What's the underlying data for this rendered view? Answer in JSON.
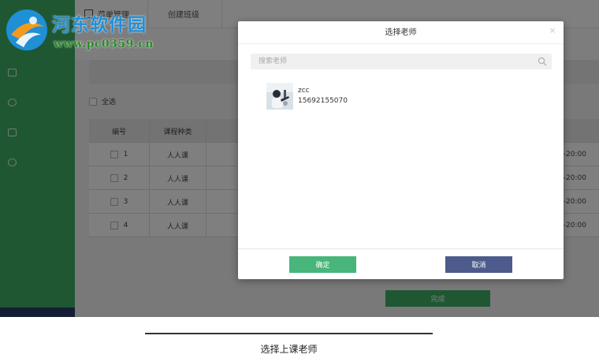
{
  "background": {
    "top_tabs": [
      "菜单管理",
      "创建班级"
    ],
    "select_all_label": "全选",
    "table": {
      "headers": [
        "编号",
        "课程种类"
      ],
      "rows": [
        {
          "num": "1",
          "type": "人人课",
          "time": "-20:00"
        },
        {
          "num": "2",
          "type": "人人课",
          "time": "-20:00"
        },
        {
          "num": "3",
          "type": "人人课",
          "time": "-20:00"
        },
        {
          "num": "4",
          "type": "人人课",
          "time": "-20:00"
        }
      ]
    },
    "done_button": "完成"
  },
  "modal": {
    "title": "选择老师",
    "search_placeholder": "搜索老师",
    "teacher": {
      "name": "zcc",
      "phone": "15692155070"
    },
    "confirm_label": "确定",
    "cancel_label": "取消"
  },
  "watermark": {
    "name": "河东软件园",
    "url": "www.pc0359.cn"
  },
  "caption": "选择上课老师",
  "colors": {
    "sidebar": "#3fae66",
    "confirm": "#48b57a",
    "cancel": "#4c5b8c",
    "watermark_blue": "#1f8fd6"
  }
}
